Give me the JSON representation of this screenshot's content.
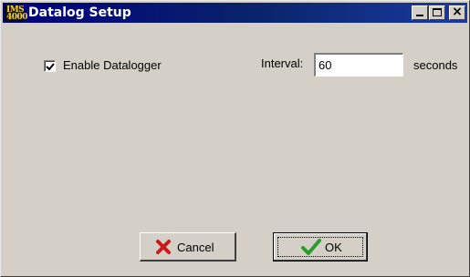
{
  "window": {
    "title": "Datalog Setup",
    "app_icon_text": "IMS\n4000",
    "controls": {
      "minimize": "minimize",
      "maximize": "maximize",
      "close": "×"
    }
  },
  "form": {
    "enable_label": "Enable Datalogger",
    "enable_checked": true,
    "interval_label": "Interval:",
    "interval_value": "60",
    "interval_unit": "seconds"
  },
  "buttons": {
    "cancel_label": "Cancel",
    "ok_label": "OK"
  },
  "icons": {
    "cancel": "red-x-icon",
    "ok": "green-checkmark-icon",
    "check": "checkmark-icon"
  },
  "colors": {
    "titlebar": "#0a246a",
    "face": "#d4d0c8",
    "cancel_icon": "#cc1a1a",
    "ok_icon": "#2e9a2e"
  }
}
